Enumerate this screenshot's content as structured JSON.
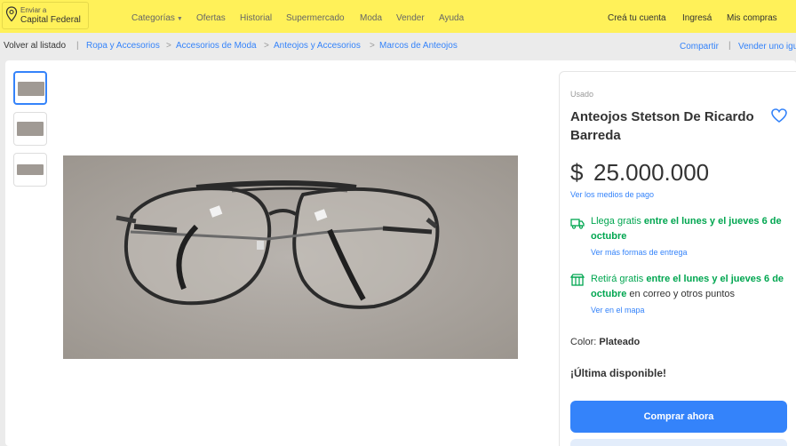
{
  "header": {
    "location_small": "Enviar a",
    "location_main": "Capital Federal",
    "nav": [
      "Categorías",
      "Ofertas",
      "Historial",
      "Supermercado",
      "Moda",
      "Vender",
      "Ayuda"
    ],
    "account": [
      "Creá tu cuenta",
      "Ingresá",
      "Mis compras"
    ],
    "icons": [
      "location-pin-icon",
      "chevron-down-icon"
    ],
    "brand_yellow": "#fff159"
  },
  "breadcrumb": {
    "back": "Volver al listado",
    "items": [
      "Ropa y Accesorios",
      "Accesorios de Moda",
      "Anteojos y Accesorios",
      "Marcos de Anteojos"
    ],
    "share": "Compartir",
    "sell": "Vender uno igual"
  },
  "product": {
    "condition": "Usado",
    "title": "Anteojos Stetson De Ricardo Barreda",
    "currency": "$",
    "price": "25.000.000",
    "payment_link": "Ver los medios de pago",
    "shipping": {
      "prefix": "Llega gratis",
      "middle": " entre el lunes y el jueves 6 de octubre",
      "link": "Ver más formas de entrega"
    },
    "pickup": {
      "prefix": "Retirá gratis",
      "middle": " entre el lunes y el jueves 6 de octubre",
      "suffix": " en correo y otros puntos",
      "link": "Ver en el mapa"
    },
    "color_label": "Color: ",
    "color_value": "Plateado",
    "availability": "¡Última disponible!",
    "buy_button": "Comprar ahora",
    "accent_blue": "#3483fa",
    "accent_green": "#00a650"
  }
}
